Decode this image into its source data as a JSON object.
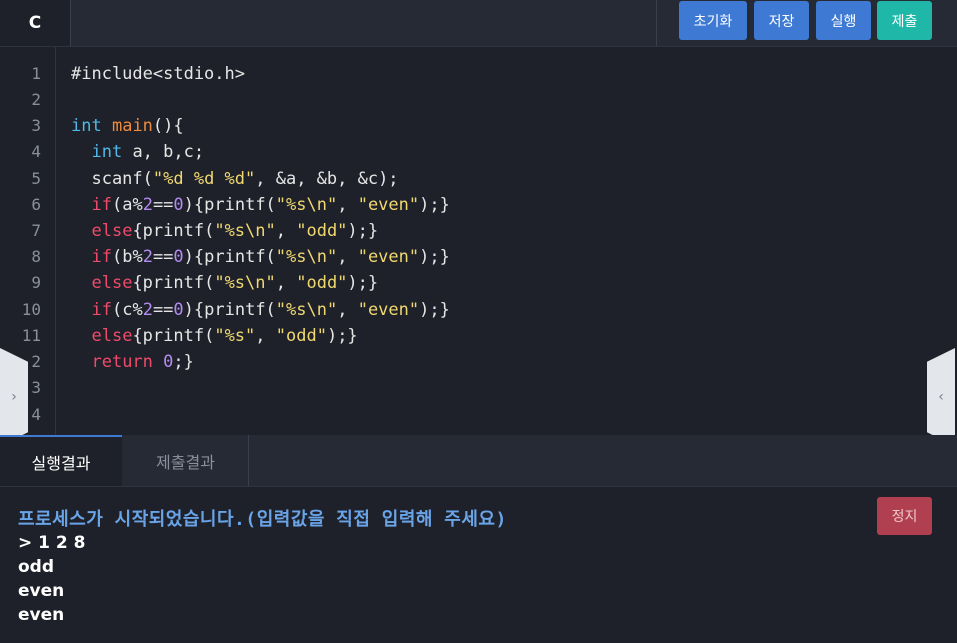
{
  "toolbar": {
    "language": "C",
    "reset_label": "초기화",
    "save_label": "저장",
    "run_label": "실행",
    "submit_label": "제출"
  },
  "editor": {
    "line_numbers": [
      "1",
      "2",
      "3",
      "4",
      "5",
      "6",
      "7",
      "8",
      "9",
      "10",
      "11",
      "2",
      "3",
      "4"
    ],
    "code": {
      "l1": "#include<stdio.h>",
      "l3_kw": "int",
      "l3_fn": "main",
      "l3_rest": "(){",
      "l4_kw": "int",
      "l4_rest": " a, b,c;",
      "l5_a": "  scanf(",
      "l5_str": "\"%d %d %d\"",
      "l5_b": ", &a, &b, &c);",
      "l6_kw": "if",
      "l6_a": "(a%",
      "l6_n1": "2",
      "l6_b": "==",
      "l6_n2": "0",
      "l6_c": "){printf(",
      "l6_s1": "\"%s\\n\"",
      "l6_d": ", ",
      "l6_s2": "\"even\"",
      "l6_e": ");}",
      "l7_kw": "else",
      "l7_a": "{printf(",
      "l7_s1": "\"%s\\n\"",
      "l7_b": ", ",
      "l7_s2": "\"odd\"",
      "l7_c": ");}",
      "l8_kw": "if",
      "l8_a": "(b%",
      "l8_n1": "2",
      "l8_b": "==",
      "l8_n2": "0",
      "l8_c": "){printf(",
      "l8_s1": "\"%s\\n\"",
      "l8_d": ", ",
      "l8_s2": "\"even\"",
      "l8_e": ");}",
      "l9_kw": "else",
      "l9_a": "{printf(",
      "l9_s1": "\"%s\\n\"",
      "l9_b": ", ",
      "l9_s2": "\"odd\"",
      "l9_c": ");}",
      "l10_kw": "if",
      "l10_a": "(c%",
      "l10_n1": "2",
      "l10_b": "==",
      "l10_n2": "0",
      "l10_c": "){printf(",
      "l10_s1": "\"%s\\n\"",
      "l10_d": ", ",
      "l10_s2": "\"even\"",
      "l10_e": ");}",
      "l11_kw": "else",
      "l11_a": "{printf(",
      "l11_s1": "\"%s\"",
      "l11_b": ", ",
      "l11_s2": "\"odd\"",
      "l11_c": ");}",
      "l12_kw": "return",
      "l12_n": "0",
      "l12_rest": ";}"
    }
  },
  "side_handles": {
    "left_icon": "chevron-right-icon",
    "left_glyph": "›",
    "right_icon": "chevron-left-icon",
    "right_glyph": "‹"
  },
  "result_tabs": {
    "run_result": "실행결과",
    "submit_result": "제출결과"
  },
  "output": {
    "status": "프로세스가 시작되었습니다.(입력값을 직접 입력해 주세요)",
    "lines": [
      "> 1 2 8",
      "odd",
      "even",
      "even"
    ],
    "stop_label": "정지"
  },
  "colors": {
    "accent_blue": "#3e7ad3",
    "submit_teal": "#1fb8a8",
    "stop_red": "#b0404f",
    "editor_bg": "#1e2129"
  }
}
